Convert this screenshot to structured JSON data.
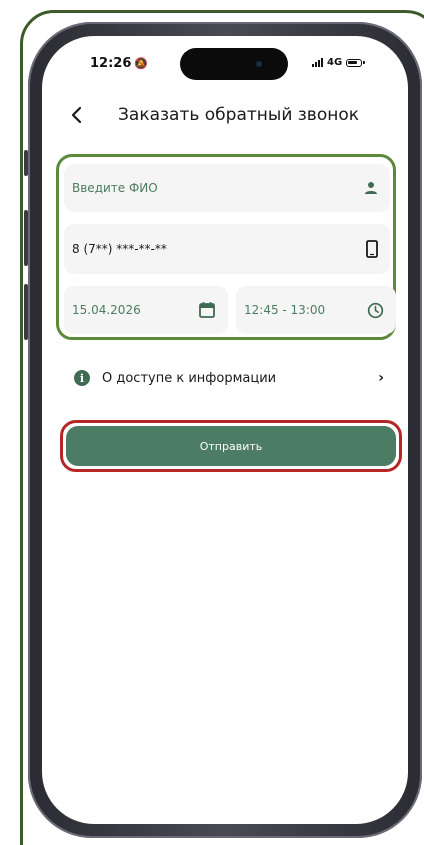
{
  "status_bar": {
    "time": "12:26",
    "network": "4G"
  },
  "header": {
    "title": "Заказать обратный звонок"
  },
  "form": {
    "name_placeholder": "Введите ФИО",
    "phone_value": "8 (7**) ***-**-**",
    "date_value": "15.04.2026",
    "time_value": "12:45 - 13:00"
  },
  "info": {
    "label": "О доступе к информации"
  },
  "submit": {
    "label": "Отправить"
  },
  "colors": {
    "accent": "#4c7c63",
    "highlight_green": "#5c8a3a",
    "highlight_red": "#b52727"
  },
  "icons": {
    "back": "chevron-left-icon",
    "name": "person-icon",
    "phone": "smartphone-icon",
    "date": "calendar-icon",
    "time": "clock-icon",
    "info": "info-icon",
    "forward": "chevron-right-icon"
  }
}
